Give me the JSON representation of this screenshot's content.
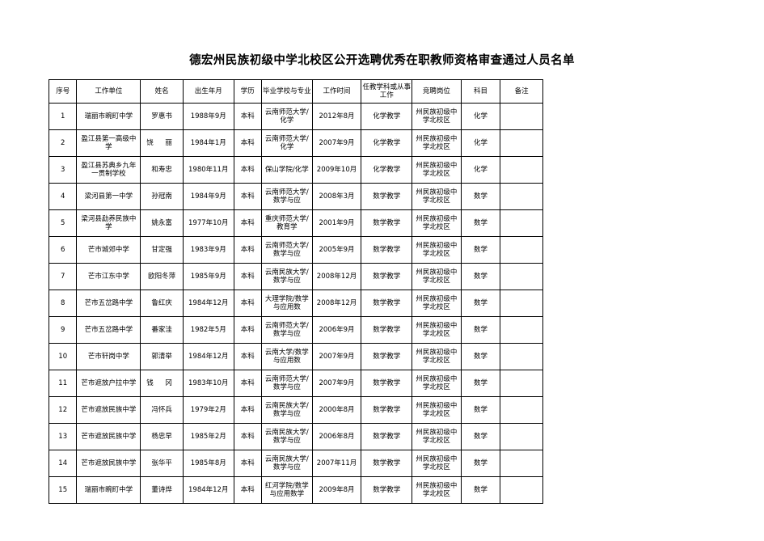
{
  "document": {
    "title": "德宏州民族初级中学北校区公开选聘优秀在职教师资格审查通过人员名单"
  },
  "table": {
    "headers": [
      "序号",
      "工作单位",
      "姓名",
      "出生年月",
      "学历",
      "毕业学校与专业",
      "工作时间",
      "任教学科或从事工作",
      "竞聘岗位",
      "科目",
      "备注"
    ],
    "rows": [
      {
        "idx": "1",
        "unit": "瑞丽市畹町中学",
        "name": "罗惠书",
        "birth": "1988年9月",
        "edu": "本科",
        "school": "云南师范大学/化学",
        "worktime": "2012年8月",
        "subject": "化学教学",
        "post": "州民族初级中学北校区",
        "course": "化学",
        "remark": ""
      },
      {
        "idx": "2",
        "unit": "盈江县第一高级中学",
        "name": "饶 丽",
        "birth": "1984年1月",
        "edu": "本科",
        "school": "云南师范大学/化学",
        "worktime": "2007年9月",
        "subject": "化学教学",
        "post": "州民族初级中学北校区",
        "course": "化学",
        "remark": ""
      },
      {
        "idx": "3",
        "unit": "盈江县苏典乡九年一贯制学校",
        "name": "和寿忠",
        "birth": "1980年11月",
        "edu": "本科",
        "school": "保山学院/化学",
        "worktime": "2009年10月",
        "subject": "化学教学",
        "post": "州民族初级中学北校区",
        "course": "化学",
        "remark": ""
      },
      {
        "idx": "4",
        "unit": "梁河县第一中学",
        "name": "孙冠南",
        "birth": "1984年9月",
        "edu": "本科",
        "school": "云南师范大学/数学与应",
        "worktime": "2008年3月",
        "subject": "数学教学",
        "post": "州民族初级中学北校区",
        "course": "数学",
        "remark": ""
      },
      {
        "idx": "5",
        "unit": "梁河县勐养民族中学",
        "name": "姚永富",
        "birth": "1977年10月",
        "edu": "本科",
        "school": "重庆师范大学/教育学",
        "worktime": "2001年9月",
        "subject": "数学教学",
        "post": "州民族初级中学北校区",
        "course": "数学",
        "remark": ""
      },
      {
        "idx": "6",
        "unit": "芒市城郊中学",
        "name": "甘定强",
        "birth": "1983年9月",
        "edu": "本科",
        "school": "云南师范大学/数学与应",
        "worktime": "2005年9月",
        "subject": "数学教学",
        "post": "州民族初级中学北校区",
        "course": "数学",
        "remark": ""
      },
      {
        "idx": "7",
        "unit": "芒市江东中学",
        "name": "欧阳冬萍",
        "birth": "1985年9月",
        "edu": "本科",
        "school": "云南民族大学/数学与应",
        "worktime": "2008年12月",
        "subject": "数学教学",
        "post": "州民族初级中学北校区",
        "course": "数学",
        "remark": ""
      },
      {
        "idx": "8",
        "unit": "芒市五岔路中学",
        "name": "鲁红庆",
        "birth": "1984年12月",
        "edu": "本科",
        "school": "大理学院/数学与应用数",
        "worktime": "2008年12月",
        "subject": "数学教学",
        "post": "州民族初级中学北校区",
        "course": "数学",
        "remark": ""
      },
      {
        "idx": "9",
        "unit": "芒市五岔路中学",
        "name": "番家洼",
        "birth": "1982年5月",
        "edu": "本科",
        "school": "云南师范大学/数学与应",
        "worktime": "2006年9月",
        "subject": "数学教学",
        "post": "州民族初级中学北校区",
        "course": "数学",
        "remark": ""
      },
      {
        "idx": "10",
        "unit": "芒市轩岗中学",
        "name": "郭清举",
        "birth": "1984年12月",
        "edu": "本科",
        "school": "云南大学/数学与应用数",
        "worktime": "2007年9月",
        "subject": "数学教学",
        "post": "州民族初级中学北校区",
        "course": "数学",
        "remark": ""
      },
      {
        "idx": "11",
        "unit": "芒市遮放户拉中学",
        "name": "钱 冈",
        "birth": "1983年10月",
        "edu": "本科",
        "school": "云南师范大学/数学与应",
        "worktime": "2007年9月",
        "subject": "数学教学",
        "post": "州民族初级中学北校区",
        "course": "数学",
        "remark": ""
      },
      {
        "idx": "12",
        "unit": "芒市遮放民族中学",
        "name": "冯怀兵",
        "birth": "1979年2月",
        "edu": "本科",
        "school": "云南民族大学/数学与应",
        "worktime": "2000年8月",
        "subject": "数学教学",
        "post": "州民族初级中学北校区",
        "course": "数学",
        "remark": ""
      },
      {
        "idx": "13",
        "unit": "芒市遮放民族中学",
        "name": "杨忠早",
        "birth": "1985年2月",
        "edu": "本科",
        "school": "云南民族大学/数学与应",
        "worktime": "2006年8月",
        "subject": "数学教学",
        "post": "州民族初级中学北校区",
        "course": "数学",
        "remark": ""
      },
      {
        "idx": "14",
        "unit": "芒市遮放民族中学",
        "name": "张华平",
        "birth": "1985年8月",
        "edu": "本科",
        "school": "云南民族大学/数学与应",
        "worktime": "2007年11月",
        "subject": "数学教学",
        "post": "州民族初级中学北校区",
        "course": "数学",
        "remark": ""
      },
      {
        "idx": "15",
        "unit": "瑞丽市畹町中学",
        "name": "董诗烨",
        "birth": "1984年12月",
        "edu": "本科",
        "school": "红河学院/数学与应用数学",
        "worktime": "2009年8月",
        "subject": "数学教学",
        "post": "州民族初级中学北校区",
        "course": "数学",
        "remark": ""
      }
    ]
  }
}
